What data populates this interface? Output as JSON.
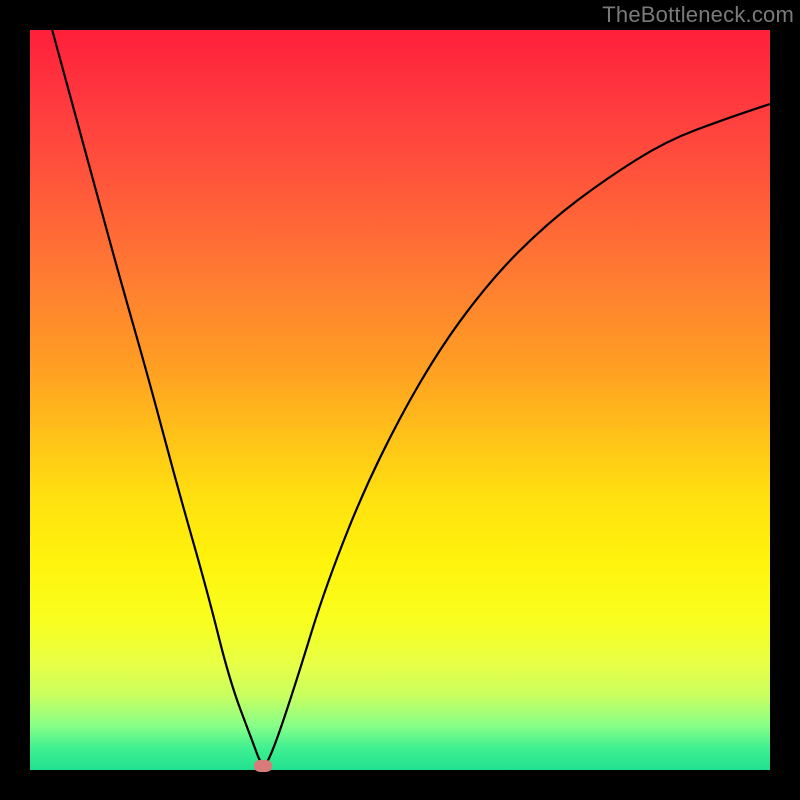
{
  "watermark": "TheBottleneck.com",
  "colors": {
    "background": "#000000",
    "curve": "#000000",
    "marker": "#d97b7b",
    "gradient_top": "#ff1f3a",
    "gradient_bottom": "#20e090"
  },
  "chart_data": {
    "type": "line",
    "title": "",
    "xlabel": "",
    "ylabel": "",
    "xlim": [
      0,
      100
    ],
    "ylim": [
      0,
      100
    ],
    "grid": false,
    "series": [
      {
        "name": "bottleneck-curve",
        "x": [
          3,
          6,
          9,
          12,
          16,
          20,
          24,
          27,
          30,
          31.5,
          33,
          36,
          40,
          46,
          54,
          62,
          70,
          78,
          86,
          94,
          100
        ],
        "values": [
          100,
          89,
          78,
          67,
          53,
          38,
          24,
          12,
          4,
          0,
          3,
          12,
          25,
          40,
          55,
          66,
          74,
          80,
          85,
          88,
          90
        ]
      }
    ],
    "annotations": [
      {
        "name": "min-marker",
        "x": 31.5,
        "y": 0.5
      }
    ]
  }
}
